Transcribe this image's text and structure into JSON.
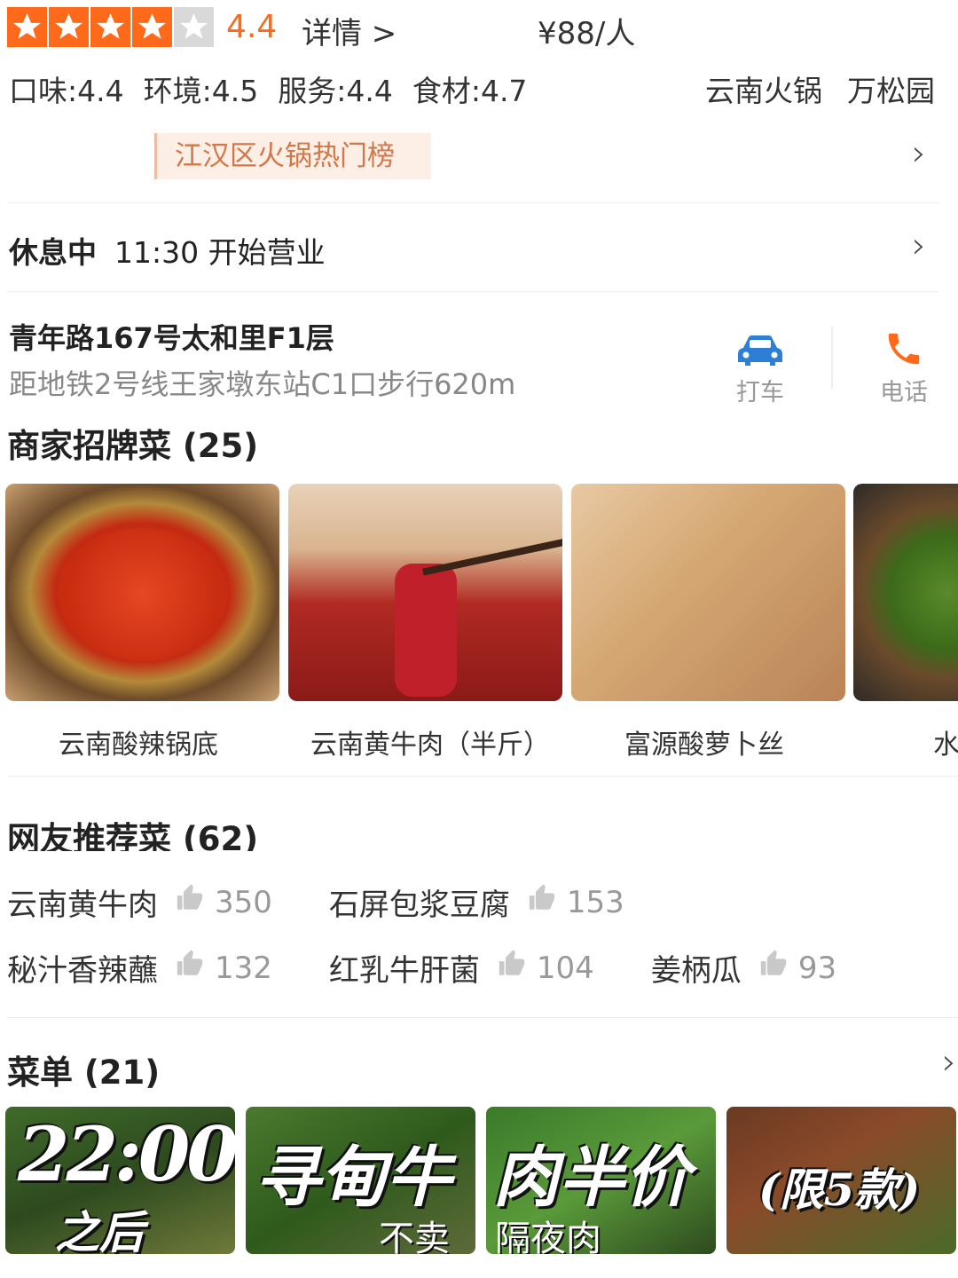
{
  "rating": {
    "score": "4.4",
    "stars_filled": 4,
    "stars_total": 5,
    "detail_label": "详情 >",
    "price": "¥88/人"
  },
  "subscores": [
    "口味:4.4",
    "环境:4.5",
    "服务:4.4",
    "食材:4.7"
  ],
  "category": {
    "cuisine": "云南火锅",
    "area": "万松园"
  },
  "rank_tag": "江汉区火锅热门榜",
  "hours": {
    "status": "休息中",
    "open_time": "11:30 开始营业"
  },
  "address": {
    "line1": "青年路167号太和里F1层",
    "metro": "距地铁2号线王家墩东站C1口步行620m"
  },
  "actions": {
    "taxi": "打车",
    "phone": "电话"
  },
  "signature": {
    "title": "商家招牌菜 (25)",
    "dishes": [
      "云南酸辣锅底",
      "云南黄牛肉（半斤）",
      "富源酸萝卜丝",
      "水"
    ]
  },
  "recommended": {
    "title": "网友推荐菜 (62)",
    "row1": [
      {
        "name": "云南黄牛肉",
        "count": "350"
      },
      {
        "name": "石屏包浆豆腐",
        "count": "153"
      }
    ],
    "row2": [
      {
        "name": "秘汁香辣蘸",
        "count": "132"
      },
      {
        "name": "红乳牛肝菌",
        "count": "104"
      },
      {
        "name": "姜柄瓜",
        "count": "93"
      }
    ]
  },
  "menu": {
    "title": "菜单 (21)",
    "tiles": [
      {
        "big": "22:00",
        "small": "之后"
      },
      {
        "big": "寻甸牛",
        "small": "不卖"
      },
      {
        "big": "肉半价",
        "small": "隔夜肉"
      },
      {
        "big": "(限5款)",
        "small": ""
      }
    ]
  },
  "colors": {
    "accent": "#ff6a1a",
    "taxi_blue": "#2d7fd6",
    "tag_bg": "#fdeee6"
  }
}
